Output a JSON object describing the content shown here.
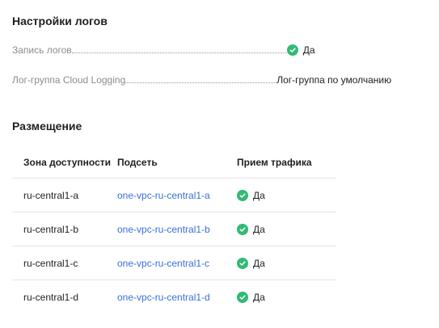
{
  "logs": {
    "title": "Настройки логов",
    "rows": [
      {
        "key": "Запись логов",
        "value": "Да",
        "checked": true
      },
      {
        "key": "Лог-группа Cloud Logging",
        "value": "Лог-группа по умолчанию",
        "checked": false
      }
    ]
  },
  "placement": {
    "title": "Размещение",
    "columns": [
      "Зона доступности",
      "Подсеть",
      "Прием трафика"
    ],
    "rows": [
      {
        "zone": "ru-central1-a",
        "subnet": "one-vpc-ru-central1-a",
        "traffic": "Да"
      },
      {
        "zone": "ru-central1-b",
        "subnet": "one-vpc-ru-central1-b",
        "traffic": "Да"
      },
      {
        "zone": "ru-central1-c",
        "subnet": "one-vpc-ru-central1-c",
        "traffic": "Да"
      },
      {
        "zone": "ru-central1-d",
        "subnet": "one-vpc-ru-central1-d",
        "traffic": "Да"
      }
    ]
  },
  "colors": {
    "check": "#32ba76",
    "link": "#3b6fd8",
    "muted": "#8c8c8c"
  }
}
